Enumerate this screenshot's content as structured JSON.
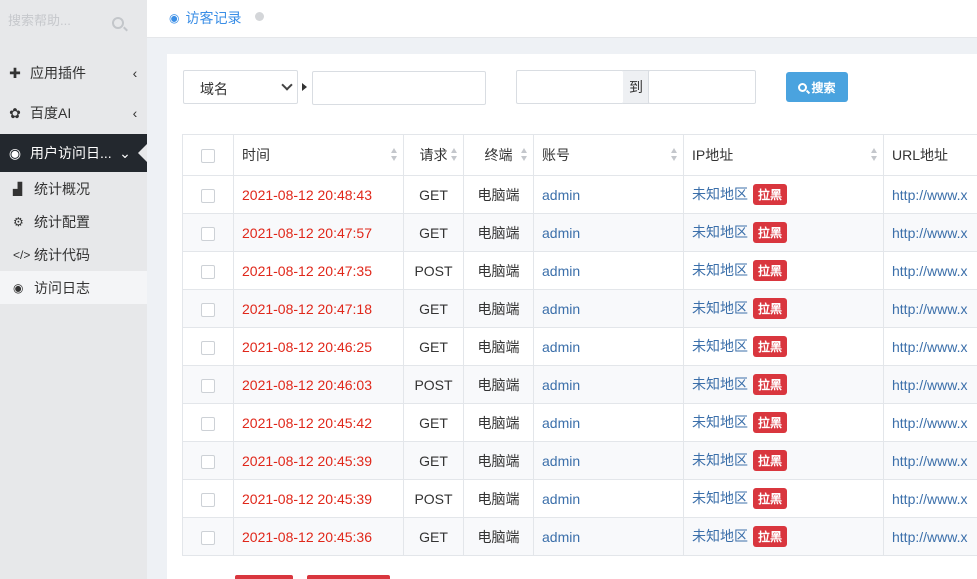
{
  "sidebar": {
    "search_placeholder": "搜索帮助...",
    "items": [
      {
        "label": "应用插件",
        "icon": "puzzle-icon"
      },
      {
        "label": "百度AI",
        "icon": "paw-icon"
      },
      {
        "label": "用户访问日...",
        "icon": "eye-icon"
      }
    ],
    "subitems": [
      {
        "label": "统计概况",
        "icon": "bar-chart-icon"
      },
      {
        "label": "统计配置",
        "icon": "gear-icon"
      },
      {
        "label": "统计代码",
        "icon": "code-icon"
      },
      {
        "label": "访问日志",
        "icon": "eye-icon"
      }
    ]
  },
  "header": {
    "tab_title": "访客记录"
  },
  "filters": {
    "field_select_value": "域名",
    "range_separator": "到",
    "search_button": "搜索"
  },
  "table": {
    "columns": [
      "时间",
      "请求",
      "终端",
      "账号",
      "IP地址",
      "URL地址"
    ],
    "blacklist_label": "拉黑",
    "rows": [
      {
        "time": "2021-08-12 20:48:43",
        "method": "GET",
        "terminal": "电脑端",
        "account": "admin",
        "ip": "未知地区",
        "url": "http://www.x"
      },
      {
        "time": "2021-08-12 20:47:57",
        "method": "GET",
        "terminal": "电脑端",
        "account": "admin",
        "ip": "未知地区",
        "url": "http://www.x"
      },
      {
        "time": "2021-08-12 20:47:35",
        "method": "POST",
        "terminal": "电脑端",
        "account": "admin",
        "ip": "未知地区",
        "url": "http://www.x"
      },
      {
        "time": "2021-08-12 20:47:18",
        "method": "GET",
        "terminal": "电脑端",
        "account": "admin",
        "ip": "未知地区",
        "url": "http://www.x"
      },
      {
        "time": "2021-08-12 20:46:25",
        "method": "GET",
        "terminal": "电脑端",
        "account": "admin",
        "ip": "未知地区",
        "url": "http://www.x"
      },
      {
        "time": "2021-08-12 20:46:03",
        "method": "POST",
        "terminal": "电脑端",
        "account": "admin",
        "ip": "未知地区",
        "url": "http://www.x"
      },
      {
        "time": "2021-08-12 20:45:42",
        "method": "GET",
        "terminal": "电脑端",
        "account": "admin",
        "ip": "未知地区",
        "url": "http://www.x"
      },
      {
        "time": "2021-08-12 20:45:39",
        "method": "GET",
        "terminal": "电脑端",
        "account": "admin",
        "ip": "未知地区",
        "url": "http://www.x"
      },
      {
        "time": "2021-08-12 20:45:39",
        "method": "POST",
        "terminal": "电脑端",
        "account": "admin",
        "ip": "未知地区",
        "url": "http://www.x"
      },
      {
        "time": "2021-08-12 20:45:36",
        "method": "GET",
        "terminal": "电脑端",
        "account": "admin",
        "ip": "未知地区",
        "url": "http://www.x"
      }
    ]
  },
  "colors": {
    "accent": "#3a8ee6",
    "time_text": "#e0271a",
    "badge": "#d9363e",
    "sidebar_active": "#23282e"
  }
}
